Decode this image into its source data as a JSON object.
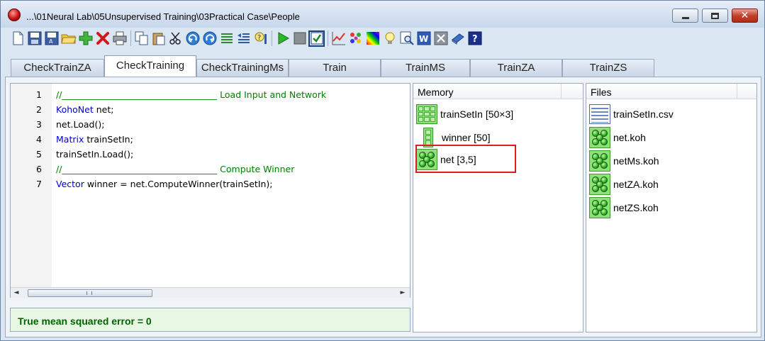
{
  "window": {
    "title": "...\\01Neural Lab\\05Unsupervised Training\\03Practical Case\\People",
    "close_glyph": "✕"
  },
  "toolbar": {
    "buttons": [
      "new",
      "save",
      "save-as",
      "open",
      "add",
      "delete",
      "print",
      "copy",
      "paste",
      "cut",
      "undo",
      "redo",
      "format",
      "outdent",
      "help-topic",
      "run",
      "stop",
      "check",
      "chart",
      "palette",
      "color-spectrum",
      "lightbulb",
      "find",
      "word",
      "excel",
      "book",
      "help"
    ]
  },
  "tabs": [
    "CheckTrainZA",
    "CheckTraining",
    "CheckTrainingMs",
    "Train",
    "TrainMS",
    "TrainZA",
    "TrainZS"
  ],
  "selected_tab": "CheckTraining",
  "editor": {
    "lines": [
      {
        "num": "1",
        "parts": [
          {
            "t": "//___________________________________ Load Input and Network",
            "c": "comment"
          }
        ]
      },
      {
        "num": "2",
        "parts": [
          {
            "t": "KohoNet",
            "c": "type"
          },
          {
            "t": " net;",
            "c": "plain"
          }
        ]
      },
      {
        "num": "3",
        "parts": [
          {
            "t": "net.Load();",
            "c": "plain"
          }
        ]
      },
      {
        "num": "4",
        "parts": [
          {
            "t": "Matrix",
            "c": "type"
          },
          {
            "t": " trainSetIn;",
            "c": "plain"
          }
        ]
      },
      {
        "num": "5",
        "parts": [
          {
            "t": "trainSetIn.Load();",
            "c": "plain"
          }
        ]
      },
      {
        "num": "6",
        "parts": [
          {
            "t": "//___________________________________ Compute Winner",
            "c": "comment"
          }
        ]
      },
      {
        "num": "7",
        "parts": [
          {
            "t": "Vector",
            "c": "type"
          },
          {
            "t": " winner = net.ComputeWinner(trainSetIn);",
            "c": "plain"
          }
        ]
      }
    ],
    "scroll_left": "◄",
    "scroll_right": "►"
  },
  "status": {
    "text": "True mean squared error = 0"
  },
  "memory": {
    "header": "Memory",
    "items": [
      {
        "label": "trainSetIn [50×3]",
        "icon": "matrix-icon"
      },
      {
        "label": "winner [50]",
        "icon": "vector-icon"
      },
      {
        "label": "net [3,5]",
        "icon": "network-icon",
        "highlighted": true
      }
    ]
  },
  "files": {
    "header": "Files",
    "items": [
      {
        "label": "trainSetIn.csv",
        "icon": "csv-file-icon"
      },
      {
        "label": "net.koh",
        "icon": "network-icon"
      },
      {
        "label": "netMs.koh",
        "icon": "network-icon"
      },
      {
        "label": "netZA.koh",
        "icon": "network-icon"
      },
      {
        "label": "netZS.koh",
        "icon": "network-icon"
      }
    ]
  },
  "colors": {
    "comment": "#008000",
    "type": "#0000cc",
    "status_text": "#006400",
    "highlight": "#dd1c1c",
    "item_green": "#8fe07a"
  }
}
